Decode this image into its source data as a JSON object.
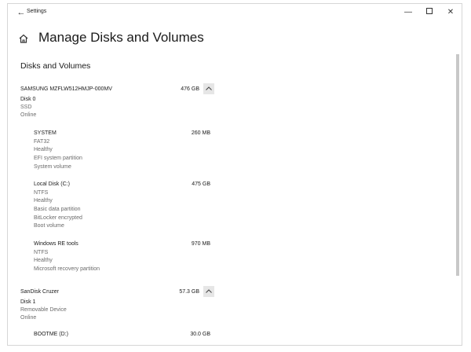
{
  "window": {
    "app_title": "Settings",
    "back_icon": "arrow-left-icon",
    "minimize_icon": "minimize-icon",
    "maximize_icon": "maximize-icon",
    "close_icon": "close-icon"
  },
  "header": {
    "home_icon": "home-icon",
    "title": "Manage Disks and Volumes"
  },
  "section": {
    "title": "Disks and Volumes"
  },
  "disks": [
    {
      "model": "SAMSUNG MZFLW512HMJP-000MV",
      "size": "476 GB",
      "details": [
        "Disk 0",
        "SSD",
        "Online"
      ],
      "collapse_icon": "chevron-up-icon",
      "volumes": [
        {
          "name": "SYSTEM",
          "size": "260 MB",
          "details": [
            "FAT32",
            "Healthy",
            "EFI system partition",
            "System volume"
          ]
        },
        {
          "name": "Local Disk (C:)",
          "size": "475 GB",
          "details": [
            "NTFS",
            "Healthy",
            "Basic data partition",
            "BitLocker encrypted",
            "Boot volume"
          ]
        },
        {
          "name": "Windows RE tools",
          "size": "970 MB",
          "details": [
            "NTFS",
            "Healthy",
            "Microsoft recovery partition"
          ]
        }
      ]
    },
    {
      "model": "SanDisk Cruzer",
      "size": "57.3 GB",
      "details": [
        "Disk 1",
        "Removable Device",
        "Online"
      ],
      "collapse_icon": "chevron-up-icon",
      "volumes": [
        {
          "name": "BOOTME (D:)",
          "size": "30.0 GB",
          "details": []
        }
      ]
    }
  ]
}
